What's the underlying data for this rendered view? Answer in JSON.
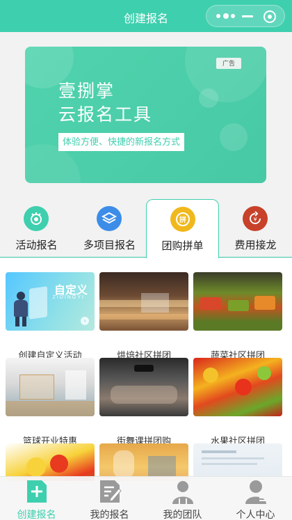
{
  "header": {
    "title": "创建报名"
  },
  "banner": {
    "ad_label": "广告",
    "line1": "壹捌掌",
    "line2": "云报名工具",
    "tagline": "体验方便、快捷的新报名方式"
  },
  "category_tabs": [
    {
      "label": "活动报名",
      "icon": "activity-badge-icon",
      "color": "#3ecfae",
      "active": false
    },
    {
      "label": "多项目报名",
      "icon": "layers-icon",
      "color": "#3c8de8",
      "active": false
    },
    {
      "label": "团购拼单",
      "icon": "group-buy-icon",
      "color": "#f0b81c",
      "active": true
    },
    {
      "label": "费用接龙",
      "icon": "fee-relay-icon",
      "color": "#c8412a",
      "active": false
    }
  ],
  "templates": [
    {
      "label": "创建自定义活动",
      "thumb_title": "自定义",
      "thumb_subtitle": "ZIDINGYI"
    },
    {
      "label": "烘焙社区拼团"
    },
    {
      "label": "蔬菜社区拼团"
    },
    {
      "label": "篮球开业特惠"
    },
    {
      "label": "街舞课拼团购"
    },
    {
      "label": "水果社区拼团"
    },
    {
      "label": ""
    },
    {
      "label": ""
    },
    {
      "label": ""
    }
  ],
  "bottom_nav": [
    {
      "label": "创建报名",
      "icon": "plus-doc-icon",
      "active": true
    },
    {
      "label": "我的报名",
      "icon": "edit-doc-icon",
      "active": false
    },
    {
      "label": "我的团队",
      "icon": "team-icon",
      "active": false
    },
    {
      "label": "个人中心",
      "icon": "user-icon",
      "active": false
    }
  ],
  "colors": {
    "accent": "#3ecfae",
    "background": "#f2f2f2"
  }
}
